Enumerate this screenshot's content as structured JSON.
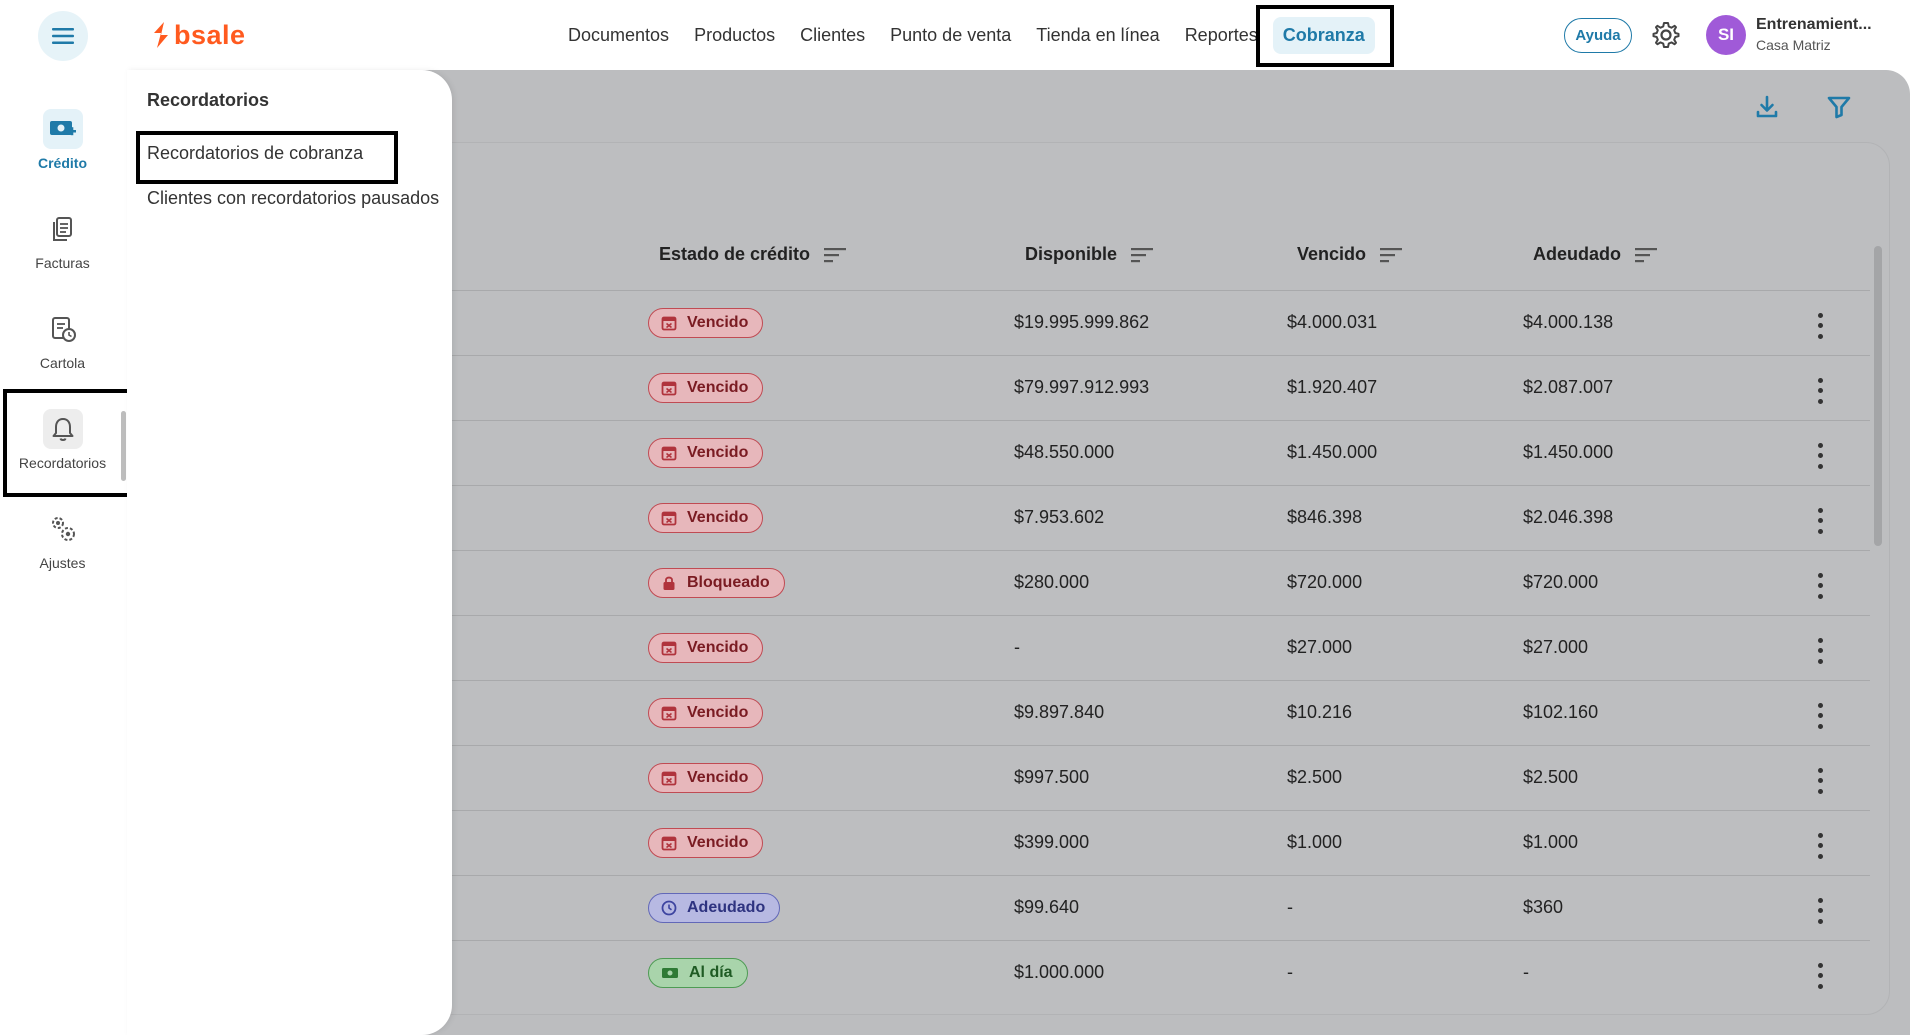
{
  "header": {
    "brand": "bsale",
    "nav": [
      "Documentos",
      "Productos",
      "Clientes",
      "Punto de venta",
      "Tienda en línea",
      "Reportes",
      "Cobranza"
    ],
    "active_nav": "Cobranza",
    "help_label": "Ayuda",
    "user": {
      "initials": "SI",
      "name": "Entrenamient...",
      "branch": "Casa Matriz",
      "avatar_color": "#a05ad8"
    }
  },
  "sidebar": {
    "items": [
      {
        "label": "Crédito",
        "icon": "credit-money-icon",
        "active": true
      },
      {
        "label": "Facturas",
        "icon": "document-icon",
        "active": false
      },
      {
        "label": "Cartola",
        "icon": "statement-clock-icon",
        "active": false
      },
      {
        "label": "Recordatorios",
        "icon": "bell-icon",
        "active": false
      },
      {
        "label": "Ajustes",
        "icon": "gears-icon",
        "active": false
      }
    ]
  },
  "flyout": {
    "title": "Recordatorios",
    "links": [
      "Recordatorios de cobranza",
      "Clientes con recordatorios pausados"
    ]
  },
  "table": {
    "columns": [
      "Estado de crédito",
      "Disponible",
      "Vencido",
      "Adeudado"
    ],
    "rows": [
      {
        "status": "Vencido",
        "status_type": "vencido",
        "disponible": "$19.995.999.862",
        "vencido": "$4.000.031",
        "adeudado": "$4.000.138"
      },
      {
        "status": "Vencido",
        "status_type": "vencido",
        "disponible": "$79.997.912.993",
        "vencido": "$1.920.407",
        "adeudado": "$2.087.007"
      },
      {
        "status": "Vencido",
        "status_type": "vencido",
        "disponible": "$48.550.000",
        "vencido": "$1.450.000",
        "adeudado": "$1.450.000"
      },
      {
        "status": "Vencido",
        "status_type": "vencido",
        "disponible": "$7.953.602",
        "vencido": "$846.398",
        "adeudado": "$2.046.398"
      },
      {
        "status": "Bloqueado",
        "status_type": "bloqueado",
        "disponible": "$280.000",
        "vencido": "$720.000",
        "adeudado": "$720.000"
      },
      {
        "status": "Vencido",
        "status_type": "vencido",
        "disponible": "-",
        "vencido": "$27.000",
        "adeudado": "$27.000"
      },
      {
        "status": "Vencido",
        "status_type": "vencido",
        "disponible": "$9.897.840",
        "vencido": "$10.216",
        "adeudado": "$102.160"
      },
      {
        "status": "Vencido",
        "status_type": "vencido",
        "disponible": "$997.500",
        "vencido": "$2.500",
        "adeudado": "$2.500"
      },
      {
        "status": "Vencido",
        "status_type": "vencido",
        "disponible": "$399.000",
        "vencido": "$1.000",
        "adeudado": "$1.000"
      },
      {
        "status": "Adeudado",
        "status_type": "adeudado",
        "disponible": "$99.640",
        "vencido": "-",
        "adeudado": "$360"
      },
      {
        "status": "Al día",
        "status_type": "aldia",
        "disponible": "$1.000.000",
        "vencido": "-",
        "adeudado": "-"
      }
    ]
  },
  "colors": {
    "accent": "#1f7aa8",
    "brand": "#ff5a1f",
    "overlay": "#bcbdbf"
  }
}
